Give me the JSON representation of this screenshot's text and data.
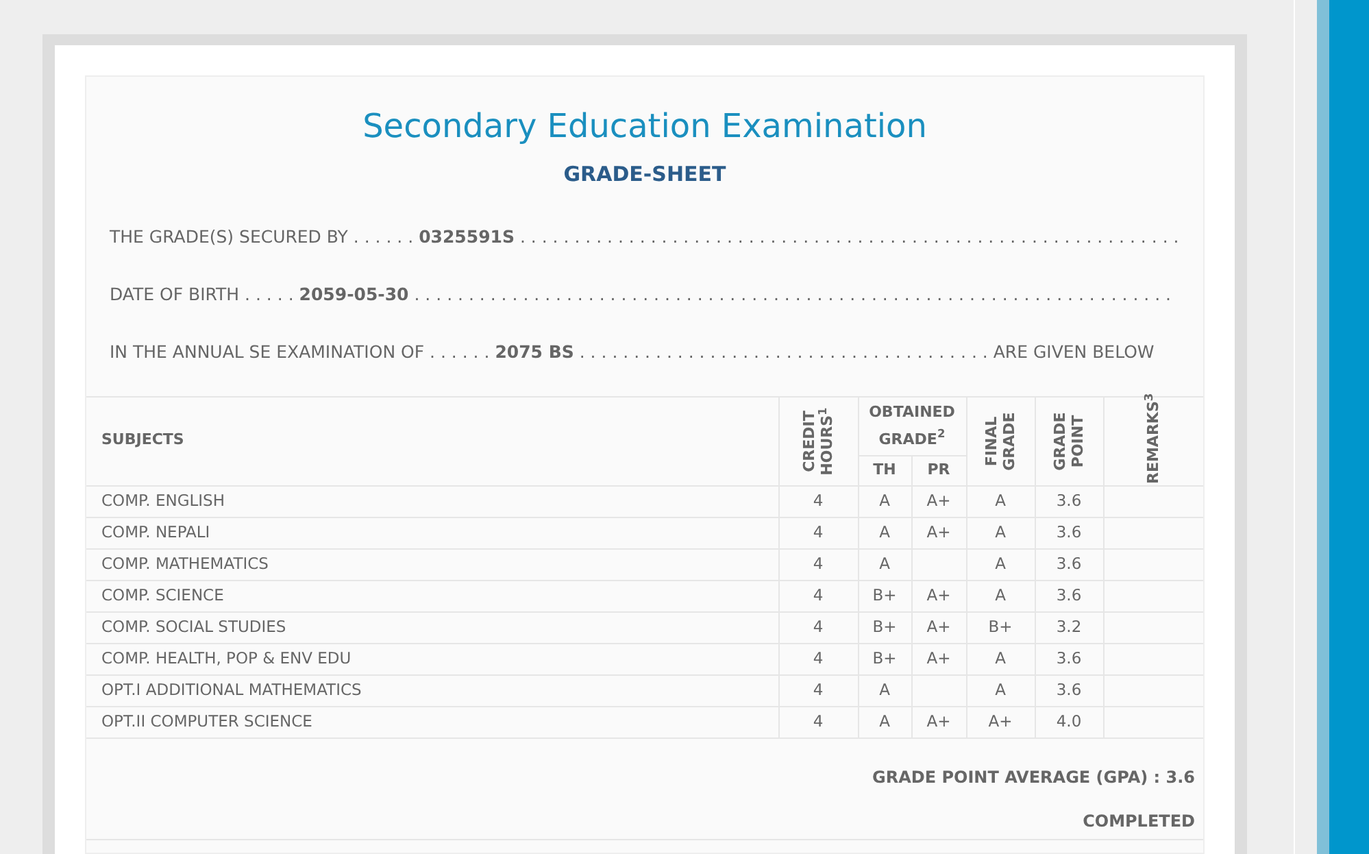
{
  "title": "Secondary Education Examination",
  "subtitle": "GRADE-SHEET",
  "statements": [
    "THE GRADE(S) SECURED BY . . . . . . **0325591S** . . . . . . . . . . . . . . . . . . . . . . . . . . . . . . . . . . . . . . . . . . . . . . . . . . . . . . . . . . . . .",
    "DATE OF BIRTH . . . . . **2059-05-30** . . . . . . . . . . . . . . . . . . . . . . . . . . . . . . . . . . . . . . . . . . . . . . . . . . . . . . . . . . . . . . . . . . . . . .",
    "IN THE ANNUAL SE EXAMINATION OF . . . . . . **2075 BS** . . . . . . . . . . . . . . . . . . . . . . . . . . . . . . . . . . . . . . ARE GIVEN BELOW"
  ],
  "table": {
    "columns": {
      "subjects": "SUBJECTS",
      "credit_hours": "CREDIT HOURS$^{1}$",
      "obtained_grade": "OBTAINED GRADE$^{2}$",
      "th": "TH",
      "pr": "PR",
      "final_grade": "FINAL GRADE",
      "grade_point": "GRADE POINT",
      "remarks": "REMARKS$^{3}$"
    },
    "rows": [
      {
        "subject": "COMP. ENGLISH",
        "credit_hours": "4",
        "th": "A",
        "pr": "A+",
        "final_grade": "A",
        "grade_point": "3.6"
      },
      {
        "subject": "COMP. NEPALI",
        "credit_hours": "4",
        "th": "A",
        "pr": "A+",
        "final_grade": "A",
        "grade_point": "3.6"
      },
      {
        "subject": "COMP. MATHEMATICS",
        "credit_hours": "4",
        "th": "A",
        "final_grade": "A",
        "grade_point": "3.6"
      },
      {
        "subject": "COMP. SCIENCE",
        "credit_hours": "4",
        "th": "B+",
        "pr": "A+",
        "final_grade": "A",
        "grade_point": "3.6"
      },
      {
        "subject": "COMP. SOCIAL STUDIES",
        "credit_hours": "4",
        "th": "B+",
        "pr": "A+",
        "final_grade": "B+",
        "grade_point": "3.2"
      },
      {
        "subject": "COMP. HEALTH, POP & ENV EDU",
        "credit_hours": "4",
        "th": "B+",
        "pr": "A+",
        "final_grade": "A",
        "grade_point": "3.6"
      },
      {
        "subject": "OPT.I ADDITIONAL MATHEMATICS",
        "credit_hours": "4",
        "th": "A",
        "final_grade": "A",
        "grade_point": "3.6"
      },
      {
        "subject": "OPT.II COMPUTER SCIENCE",
        "credit_hours": "4",
        "th": "A",
        "pr": "A+",
        "final_grade": "A+",
        "grade_point": "4.0"
      }
    ]
  },
  "gpa": "GRADE POINT AVERAGE (GPA) : 3.6",
  "result": "COMPLETED"
}
